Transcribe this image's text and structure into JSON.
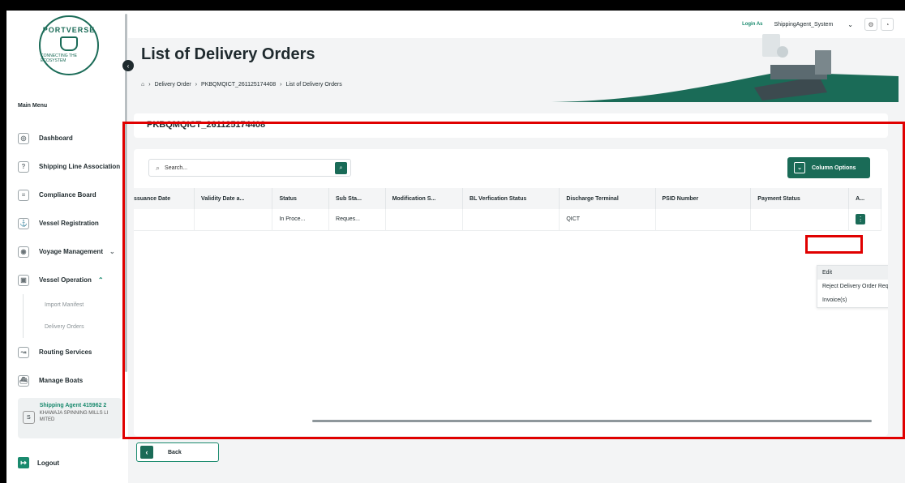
{
  "brand": {
    "logo_text": "PORTVERSE",
    "tagline": "CONNECTING THE ECOSYSTEM"
  },
  "sidebar": {
    "heading": "Main Menu",
    "items": [
      {
        "label": "Dashboard",
        "icon": "dashboard-icon"
      },
      {
        "label": "Shipping Line Association",
        "icon": "association-icon"
      },
      {
        "label": "Compliance Board",
        "icon": "clipboard-icon"
      },
      {
        "label": "Vessel Registration",
        "icon": "ship-icon"
      },
      {
        "label": "Voyage Management",
        "icon": "compass-icon"
      },
      {
        "label": "Vessel Operation",
        "icon": "operation-icon"
      },
      {
        "label": "Import Manifest"
      },
      {
        "label": "Delivery Orders"
      },
      {
        "label": "Routing Services",
        "icon": "route-icon"
      },
      {
        "label": "Manage Boats",
        "icon": "boat-icon"
      }
    ],
    "agent": {
      "avatar": "S",
      "name": "Shipping Agent 415962 2",
      "org": "KHAWAJA SPINNING MILLS LI MITED"
    },
    "logout": "Logout"
  },
  "topbar": {
    "login_as": "Login As",
    "role": "ShippingAgent_System"
  },
  "header": {
    "title": "List of Delivery Orders",
    "breadcrumb": [
      "Delivery Order",
      "PKBQMQICT_261125174408",
      "List of Delivery Orders"
    ]
  },
  "content": {
    "do_number": "PKBQMQICT_261125174408",
    "search_placeholder": "Search...",
    "column_options": "Column Options",
    "columns": [
      "ssuance Date",
      "Validity Date a...",
      "Status",
      "Sub Sta...",
      "Modification S...",
      "BL Verfication Status",
      "Discharge Terminal",
      "PSID Number",
      "Payment Status",
      "A..."
    ],
    "rows": [
      [
        "",
        "",
        "In Proce...",
        "Reques...",
        "",
        "",
        "QICT",
        "",
        ""
      ]
    ],
    "action_menu": [
      "Edit",
      "Reject Delivery Order Request",
      "Invoice(s)"
    ]
  },
  "footer": {
    "back": "Back"
  },
  "colors": {
    "primary": "#1a6b57",
    "accent": "#1a8a6e",
    "highlight": "#e00000"
  }
}
